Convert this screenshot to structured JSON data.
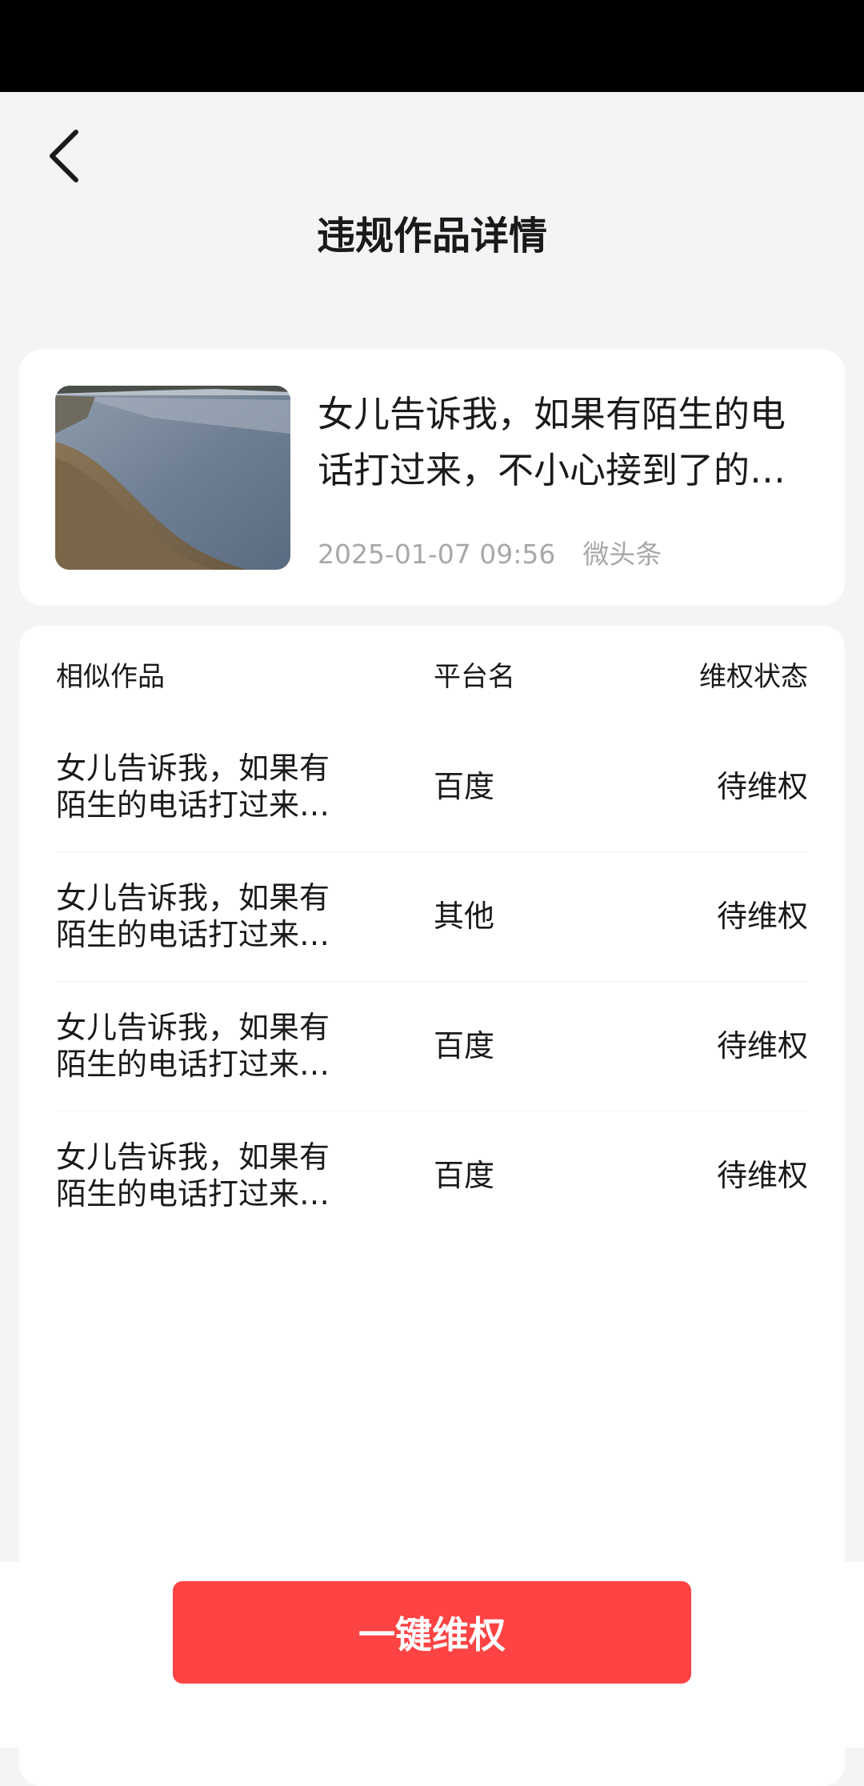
{
  "header": {
    "title": "违规作品详情"
  },
  "work": {
    "title": "女儿告诉我，如果有陌生的电话打过来，不小心接到了的…",
    "datetime": "2025-01-07 09:56",
    "platform": "微头条"
  },
  "similar": {
    "columns": {
      "works": "相似作品",
      "platform": "平台名",
      "status": "维权状态"
    },
    "rows": [
      {
        "title": "女儿告诉我，如果有陌生的电话打过来…",
        "platform": "百度",
        "status": "待维权"
      },
      {
        "title": "女儿告诉我，如果有陌生的电话打过来…",
        "platform": "其他",
        "status": "待维权"
      },
      {
        "title": "女儿告诉我，如果有陌生的电话打过来…",
        "platform": "百度",
        "status": "待维权"
      },
      {
        "title": "女儿告诉我，如果有陌生的电话打过来…",
        "platform": "百度",
        "status": "待维权"
      }
    ]
  },
  "action": {
    "label": "一键维权"
  },
  "colors": {
    "accent": "#fd4343",
    "background": "#f3f4f6",
    "meta_text": "#a8a8a8"
  }
}
